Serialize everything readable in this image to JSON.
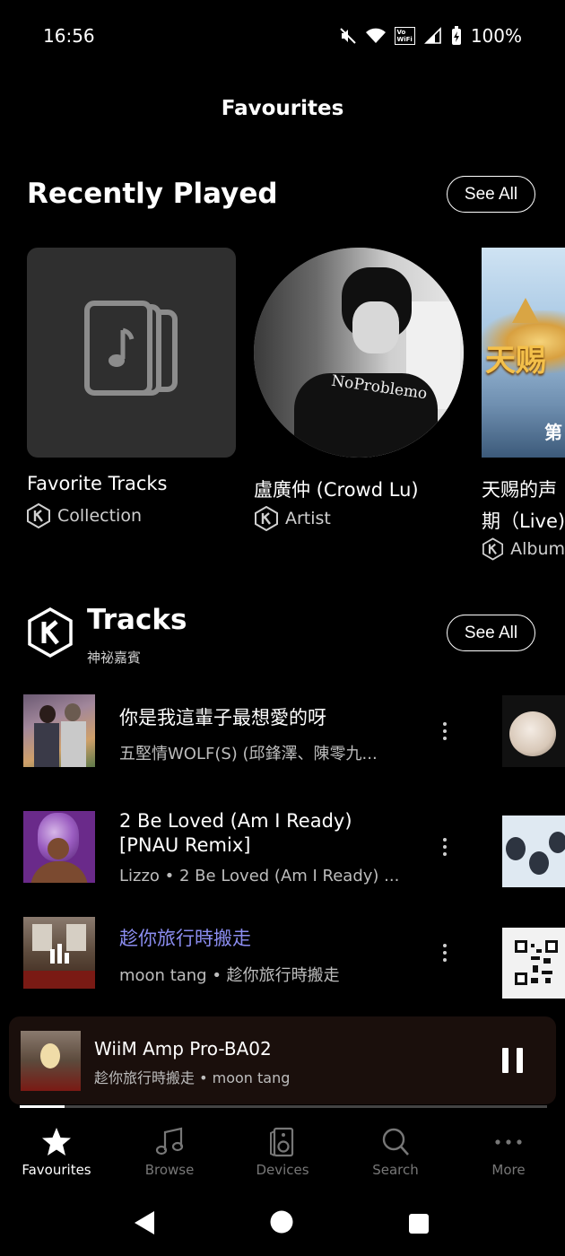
{
  "status_bar": {
    "time": "16:56",
    "vowifi_line1": "Vo",
    "vowifi_line2": "WiFi",
    "battery": "100%"
  },
  "page_title": "Favourites",
  "recently_played": {
    "title": "Recently Played",
    "see_all": "See All",
    "items": [
      {
        "title": "Favorite Tracks",
        "subtitle": "Collection"
      },
      {
        "title": "盧廣仲 (Crowd Lu)",
        "subtitle": "Artist",
        "shirt_text": "NoProblemo"
      },
      {
        "title_line1": "天赐的声",
        "title_line2": "期（Live)",
        "subtitle": "Album",
        "cover_text": "天赐",
        "cover_subtext": "第"
      }
    ]
  },
  "tracks": {
    "title": "Tracks",
    "subtitle": "神祕嘉賓",
    "see_all": "See All",
    "items": [
      {
        "title": "你是我這輩子最想愛的呀",
        "subtitle": "五堅情WOLF(S) (邱鋒澤、陳零九..."
      },
      {
        "title_line1": "2 Be Loved (Am I Ready)",
        "title_line2": "[PNAU Remix]",
        "subtitle": "Lizzo • 2 Be Loved (Am I Ready) ..."
      },
      {
        "title": "趁你旅行時搬走",
        "subtitle": "moon tang • 趁你旅行時搬走",
        "playing": true
      }
    ]
  },
  "now_playing": {
    "device": "WiiM Amp Pro-BA02",
    "track": "趁你旅行時搬走 • moon tang",
    "progress": 0.085
  },
  "bottom_nav": [
    {
      "label": "Favourites",
      "icon": "star-icon",
      "active": true
    },
    {
      "label": "Browse",
      "icon": "music-note-icon",
      "active": false
    },
    {
      "label": "Devices",
      "icon": "speaker-icon",
      "active": false
    },
    {
      "label": "Search",
      "icon": "search-icon",
      "active": false
    },
    {
      "label": "More",
      "icon": "more-dots-icon",
      "active": false
    }
  ],
  "colors": {
    "accent_playing": "#8b8df0",
    "background": "#000000",
    "mini_player_bg": "#1a0f0c"
  }
}
